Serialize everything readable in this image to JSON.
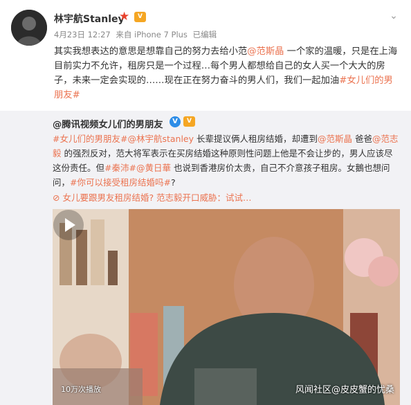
{
  "post": {
    "username": "林宇航Stanley",
    "meta": {
      "date": "4月23日 12:27",
      "source": "来自 iPhone 7 Plus",
      "edited": "已编辑"
    },
    "body": {
      "t1": "其实我想表达的意思是想靠自己的努力去给小范",
      "mention": "@范斯晶",
      "t2": " 一个家的温暖，只是在上海目前实力不允许，租房只是一个过程…每个男人都想给自己的女人买一个大大的房子，未来一定会实现的……现在正在努力奋斗的男人们，我们一起加油",
      "hashtag": "#女儿们的男朋友#"
    }
  },
  "repost": {
    "author": "@腾讯视频女儿们的男朋友",
    "text": {
      "tag1": "#女儿们的男朋友#",
      "m1": "@林宇航stanley",
      "t1": " 长辈提议俩人租房结婚，却遭到",
      "m2": "@范斯晶",
      "t2": " 爸爸",
      "m3": "@范志毅",
      "t3": " 的强烈反对，范大将军表示在买房结婚这种原则性问题上他是不会让步的，男人应该尽这份责任。但",
      "tag2": "#秦沛#",
      "m4": "@黄日華",
      "t4": " 也说到香港房价太贵，自己不介意孩子租房。女鵝也想问问，",
      "tag3": "#你可以接受租房结婚吗#",
      "t5": "?"
    },
    "video_link": "女儿要跟男友租房结婚? 范志毅开口威胁：试试…",
    "video": {
      "views": "10万次播放",
      "watermark": "风闻社区@皮皮蟹的忧桑"
    }
  },
  "icons": {
    "avatar": "avatar",
    "star": "red-star-icon",
    "vip": "vip-badge-icon",
    "verified": "verified-v-icon",
    "chevron": "chevron-down-icon",
    "play": "play-icon",
    "video": "video-link-icon"
  },
  "colors": {
    "link": "#eb7350",
    "repost_bg": "#f2f2f5",
    "verified": "#2d8de7"
  }
}
